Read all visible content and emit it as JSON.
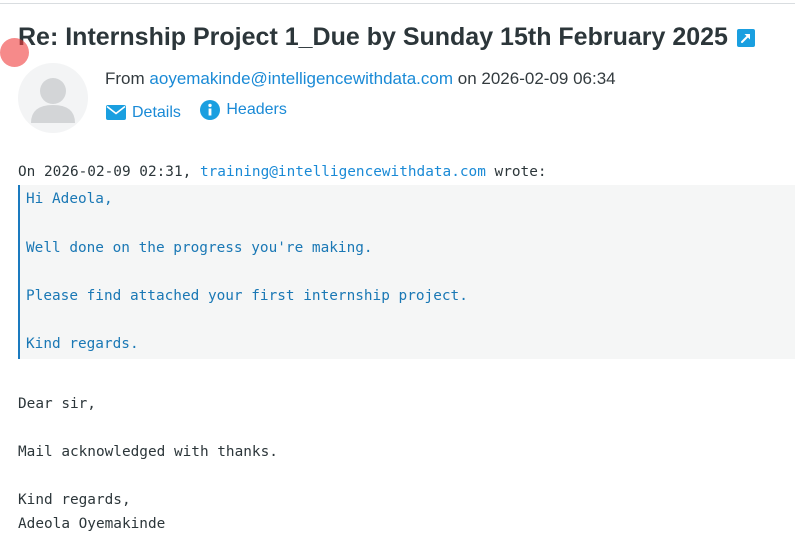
{
  "message": {
    "subject": "Re: Internship Project 1_Due by Sunday 15th February 2025",
    "from_prefix": "From",
    "from_address": "aoyemakinde@intelligencewithdata.com",
    "date_prefix": "on",
    "date": "2026-02-09 06:34",
    "actions": {
      "details": "Details",
      "headers": "Headers"
    }
  },
  "body": {
    "quote_attribution": {
      "prefix": "On 2026-02-09 02:31,",
      "address": "training@intelligencewithdata.com",
      "suffix": "wrote:"
    },
    "quoted_lines": [
      "Hi Adeola,",
      "Well done on the progress you're making.",
      "Please find attached your first internship project.",
      "Kind regards."
    ],
    "reply_lines": [
      "Dear sir,",
      "Mail acknowledged with thanks.",
      "Kind regards,",
      "Adeola Oyemakinde"
    ]
  },
  "icons": {
    "open_external": "external-link-icon",
    "avatar": "user-avatar-icon",
    "details": "envelope-icon",
    "headers": "info-icon"
  },
  "colors": {
    "link": "#1a8ad6",
    "accent": "#1a9fe0",
    "quote_text": "#1a78b5",
    "quote_border": "#1a7abf",
    "text": "#2c363a"
  }
}
